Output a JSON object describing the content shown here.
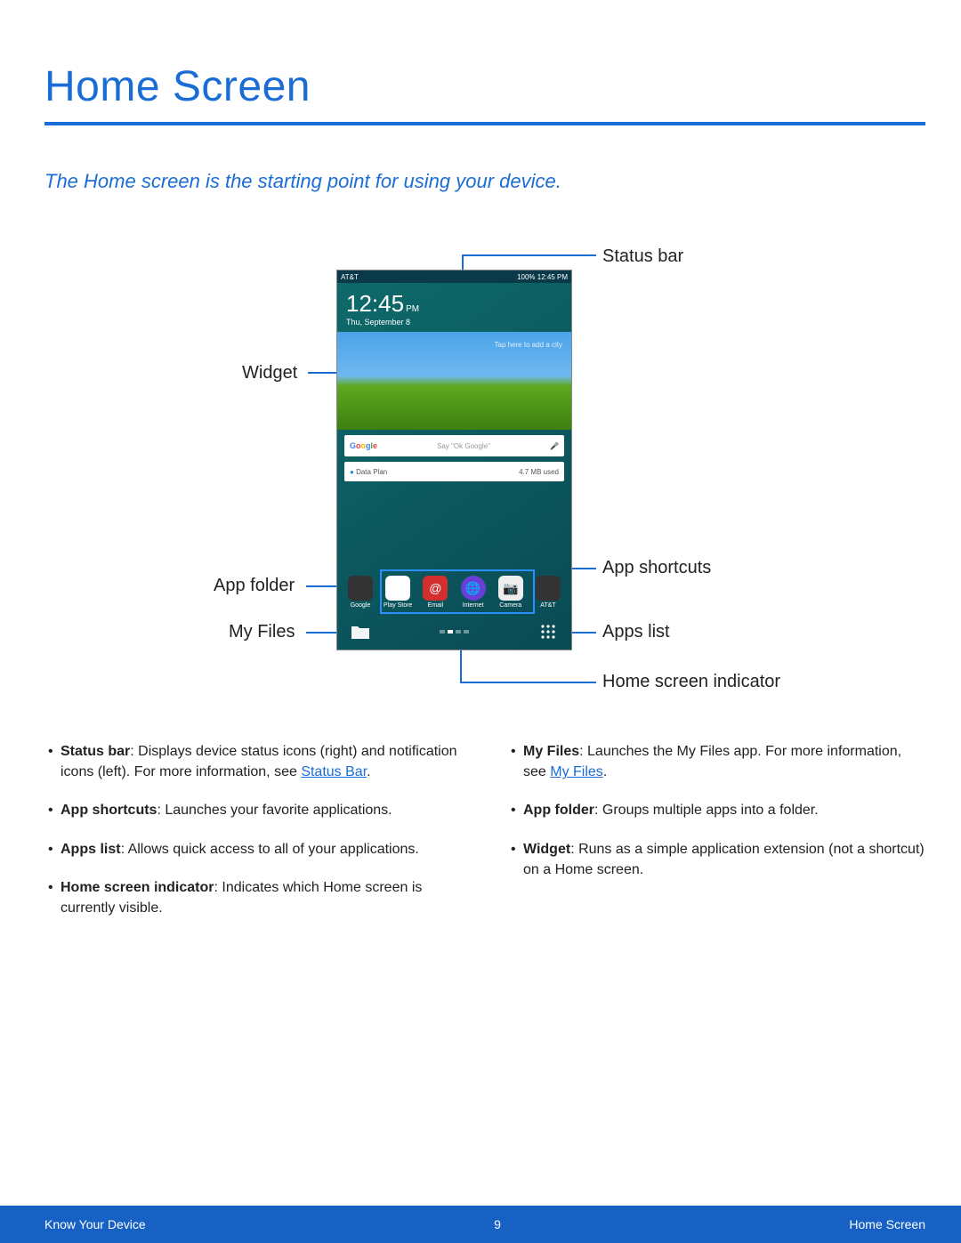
{
  "page": {
    "title": "Home Screen",
    "intro": "The Home screen is the starting point for using your device.",
    "footer_left": "Know Your Device",
    "footer_page": "9",
    "footer_right": "Home Screen"
  },
  "labels": {
    "status_bar": "Status bar",
    "widget": "Widget",
    "app_folder": "App folder",
    "my_files": "My Files",
    "app_shortcuts": "App shortcuts",
    "apps_list": "Apps list",
    "home_indicator": "Home screen indicator"
  },
  "phone": {
    "carrier": "AT&T",
    "status_right": "100%   12:45 PM",
    "clock": "12:45",
    "ampm": "PM",
    "date": "Thu, September 8",
    "add_city": "Tap here to add a city",
    "google_hint": "Say \"Ok Google\"",
    "dataplan_label": "Data Plan",
    "dataplan_used": "4.7 MB used",
    "apps": {
      "google": "Google",
      "playstore": "Play Store",
      "email": "Email",
      "internet": "Internet",
      "camera": "Camera",
      "att": "AT&T"
    }
  },
  "bullets": {
    "left": [
      {
        "term": "Status bar",
        "text": ": Displays device status icons (right) and notification icons (left). For more information, see ",
        "link": "Status Bar",
        "tail": "."
      },
      {
        "term": "App shortcuts",
        "text": ": Launches your favorite applications."
      },
      {
        "term": "Apps list",
        "text": ": Allows quick access to all of your applications."
      },
      {
        "term": "Home screen indicator",
        "text": ": Indicates which Home screen is currently visible."
      }
    ],
    "right": [
      {
        "term": "My Files",
        "text": ": Launches the My Files app. For more information, see ",
        "link": "My Files",
        "tail": "."
      },
      {
        "term": "App folder",
        "text": ": Groups multiple apps into a folder."
      },
      {
        "term": "Widget",
        "text": ": Runs as a simple application extension (not a shortcut) on a Home screen."
      }
    ]
  }
}
